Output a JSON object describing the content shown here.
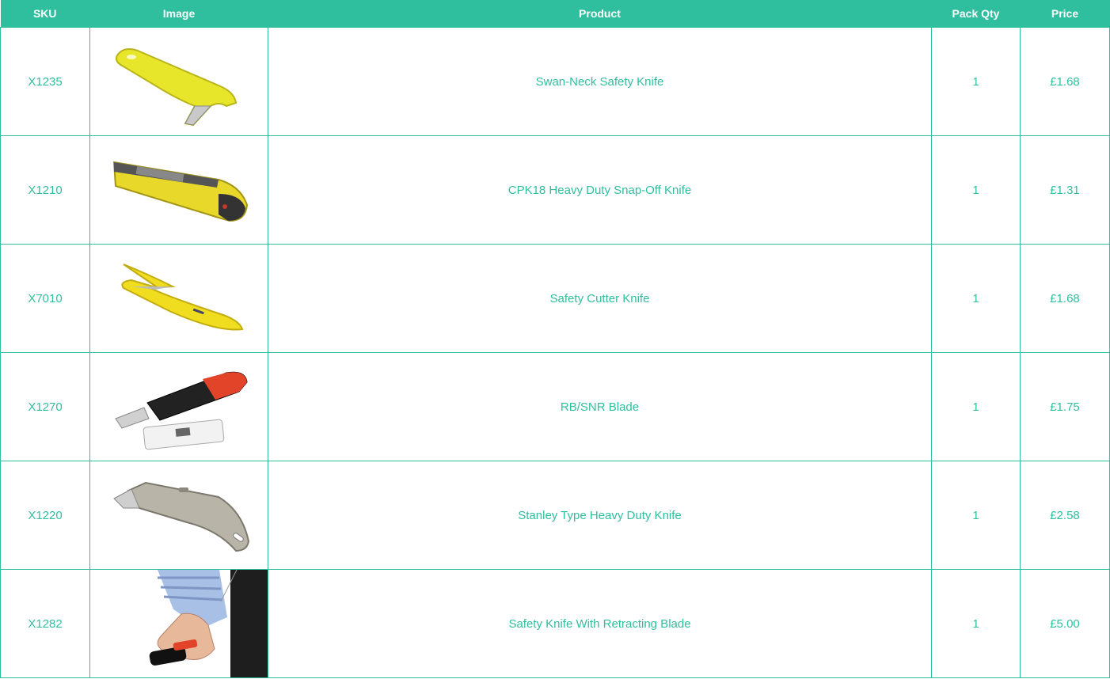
{
  "headers": [
    "SKU",
    "Image",
    "Product",
    "Pack Qty",
    "Price"
  ],
  "rows": [
    {
      "sku": "X1235",
      "image_icon": "swan-neck-knife-image",
      "product": "Swan-Neck Safety Knife",
      "qty": "1",
      "price": "£1.68"
    },
    {
      "sku": "X1210",
      "image_icon": "snap-off-knife-image",
      "product": "CPK18 Heavy Duty Snap-Off Knife",
      "qty": "1",
      "price": "£1.31"
    },
    {
      "sku": "X7010",
      "image_icon": "safety-cutter-image",
      "product": "Safety Cutter Knife",
      "qty": "1",
      "price": "£1.68"
    },
    {
      "sku": "X1270",
      "image_icon": "rb-snr-blade-image",
      "product": "RB/SNR Blade",
      "qty": "1",
      "price": "£1.75"
    },
    {
      "sku": "X1220",
      "image_icon": "stanley-knife-image",
      "product": "Stanley Type Heavy Duty Knife",
      "qty": "1",
      "price": "£2.58"
    },
    {
      "sku": "X1282",
      "image_icon": "retracting-knife-image",
      "product": "Safety Knife With Retracting Blade",
      "qty": "1",
      "price": "£5.00"
    }
  ],
  "colors": {
    "accent": "#2fbf9f",
    "header_text": "#ffffff"
  }
}
